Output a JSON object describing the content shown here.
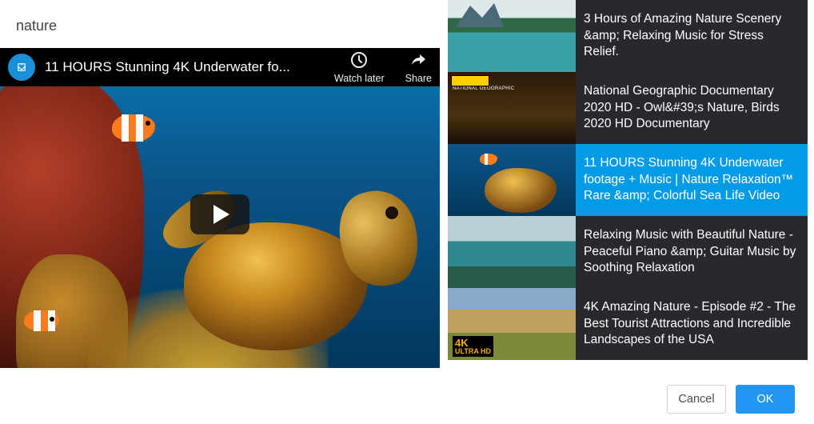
{
  "search": {
    "value": "nature"
  },
  "player": {
    "title": "11 HOURS Stunning 4K Underwater fo...",
    "watch_later": "Watch later",
    "share": "Share"
  },
  "playlist": {
    "items": [
      {
        "title": "3 Hours of Amazing Nature Scenery &amp; Relaxing Music for Stress Relief.",
        "thumb": "river",
        "selected": false
      },
      {
        "title": "National Geographic Documentary 2020 HD - Owl&#39;s Nature, Birds 2020 HD Documentary",
        "thumb": "owl",
        "selected": false,
        "badge": "NATIONAL GEOGRAPHIC"
      },
      {
        "title": "11 HOURS Stunning 4K Underwater footage + Music | Nature Relaxation™ Rare &amp; Colorful Sea Life Video",
        "thumb": "sea",
        "selected": true
      },
      {
        "title": "Relaxing Music with Beautiful Nature - Peaceful Piano &amp; Guitar Music by Soothing Relaxation",
        "thumb": "piano",
        "selected": false
      },
      {
        "title": "4K Amazing Nature - Episode #2 - The Best Tourist Attractions and Incredible Landscapes of the USA",
        "thumb": "usa",
        "selected": false,
        "tag_big": "4K",
        "tag_small": "ULTRA HD"
      }
    ]
  },
  "footer": {
    "cancel": "Cancel",
    "ok": "OK"
  }
}
